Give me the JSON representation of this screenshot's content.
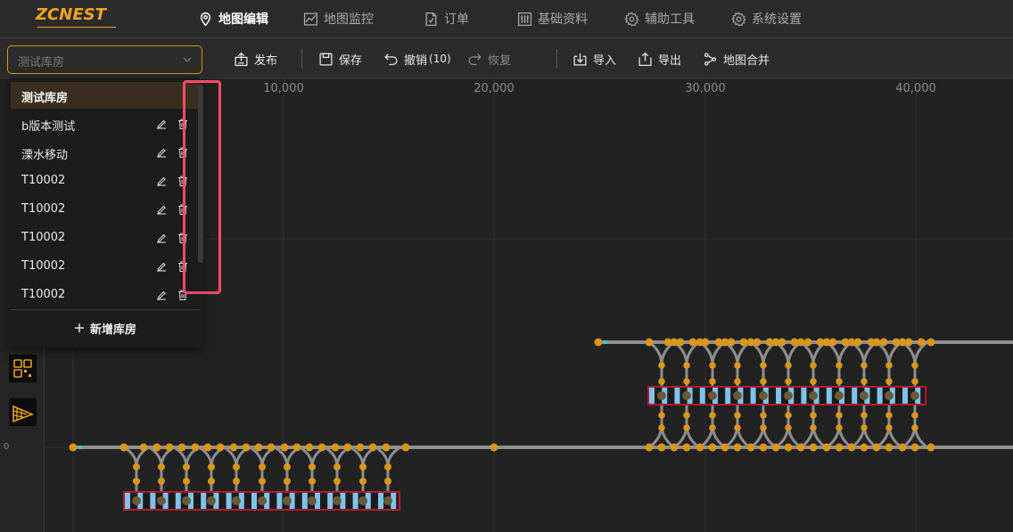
{
  "brand": {
    "logo_text": "ZCNEST"
  },
  "nav": [
    {
      "label": "地图编辑",
      "icon": "map-pin-icon",
      "active": true
    },
    {
      "label": "地图监控",
      "icon": "line-chart-icon",
      "active": false
    },
    {
      "label": "订单",
      "icon": "document-icon",
      "active": false
    },
    {
      "label": "基础资料",
      "icon": "sliders-icon",
      "active": false
    },
    {
      "label": "辅助工具",
      "icon": "gear-icon",
      "active": false
    },
    {
      "label": "系统设置",
      "icon": "gear-icon",
      "active": false
    }
  ],
  "warehouse_select": {
    "value": "测试库房"
  },
  "toolbar": {
    "publish": "发布",
    "save": "保存",
    "undo": "撤销",
    "undo_count": "(10)",
    "redo": "恢复",
    "import": "导入",
    "export": "导出",
    "merge": "地图合并"
  },
  "warehouse_menu": {
    "items": [
      {
        "label": "测试库房",
        "selected": true
      },
      {
        "label": "b版本测试",
        "selected": false
      },
      {
        "label": "溧水移动",
        "selected": false
      },
      {
        "label": "T10002",
        "selected": false
      },
      {
        "label": "T10002",
        "selected": false
      },
      {
        "label": "T10002",
        "selected": false
      },
      {
        "label": "T10002",
        "selected": false
      },
      {
        "label": "T10002",
        "selected": false
      }
    ],
    "add_label": "新增库房"
  },
  "map": {
    "ruler_x": [
      "10,000",
      "20,000",
      "30,000",
      "40,000"
    ],
    "ruler_y_zero": "0"
  },
  "colors": {
    "accent": "#f1a51d",
    "node": "#d9961c",
    "track": "#8f8f8f",
    "slot": "#7ec3ee",
    "rack_border": "#b3192b",
    "highlight": "#ff4a6a"
  }
}
